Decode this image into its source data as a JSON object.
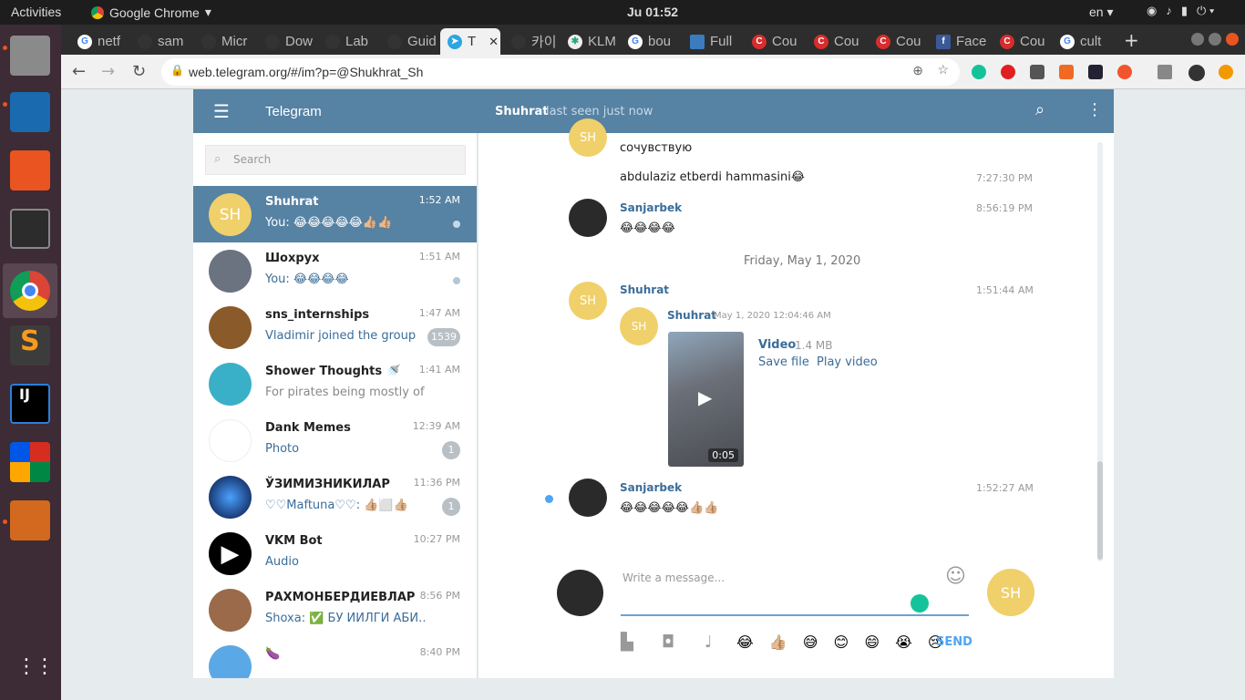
{
  "system": {
    "activities": "Activities",
    "app": "Google Chrome",
    "clock": "Ju 01:52",
    "lang": "en"
  },
  "browser": {
    "tabs": [
      "netf",
      "sam",
      "Micr",
      "Dow",
      "Lab",
      "Guid",
      "T",
      "카이",
      "KLM",
      "bou",
      "Full",
      "Cou",
      "Cou",
      "Cou",
      "Face",
      "Cou",
      "cult"
    ],
    "url": "web.telegram.org/#/im?p=@Shukhrat_Sh"
  },
  "telegram": {
    "app_title": "Telegram",
    "peer_name": "Shuhrat",
    "peer_status": "last seen just now",
    "search_placeholder": "Search",
    "chats": [
      {
        "name": "Shuhrat",
        "time": "1:52 AM",
        "preview": "You: 😂😂😂😂😂👍🏼👍🏼",
        "avatar": "SH"
      },
      {
        "name": "Шохрух",
        "time": "1:51 AM",
        "preview": "You: 😂😂😂😂"
      },
      {
        "name": "sns_internships",
        "time": "1:47 AM",
        "preview": "Vladimir joined the group",
        "badge": "1539"
      },
      {
        "name": "Shower Thoughts 🚿",
        "time": "1:41 AM",
        "preview": "For pirates being mostly of …"
      },
      {
        "name": "Dank Memes",
        "time": "12:39 AM",
        "preview": "Photo",
        "badge": "1"
      },
      {
        "name": "ЎЗИМИЗНИКИЛАР",
        "time": "11:36 PM",
        "preview": "♡♡Maftuna♡♡: 👍🏼⬜👍🏼",
        "badge": "1"
      },
      {
        "name": "VKM Bot",
        "time": "10:27 PM",
        "preview": "Audio"
      },
      {
        "name": "РАХМОНБЕРДИЕВЛАР",
        "time": "8:56 PM",
        "preview": "Shoxa: ✅ БУ ЙИЛГИ АБИ…"
      },
      {
        "name": "🍆",
        "time": "8:40 PM",
        "preview": ""
      }
    ],
    "messages": {
      "m1_text": "сочувствую",
      "m2_text": "abdulaziz etberdi hammasini😂",
      "m2_time": "7:27:30 PM",
      "m3_sender": "Sanjarbek",
      "m3_time": "8:56:19 PM",
      "m3_text": "😂😂😂😂",
      "date_sep": "Friday, May 1, 2020",
      "m4_sender": "Shuhrat",
      "m4_time": "1:51:44 AM",
      "fwd_sender": "Shuhrat",
      "fwd_date": "May 1, 2020 12:04:46 AM",
      "video_label": "Video",
      "video_size": "1.4 MB",
      "save_file": "Save file",
      "play_video": "Play video",
      "video_duration": "0:05",
      "m5_sender": "Sanjarbek",
      "m5_time": "1:52:27 AM",
      "m5_text": "😂😂😂😂😂👍🏼👍🏼"
    },
    "composer": {
      "placeholder": "Write a message...",
      "send": "SEND",
      "emojis": "😂 👍🏼 😅 😊 😄 😭 😢"
    }
  }
}
